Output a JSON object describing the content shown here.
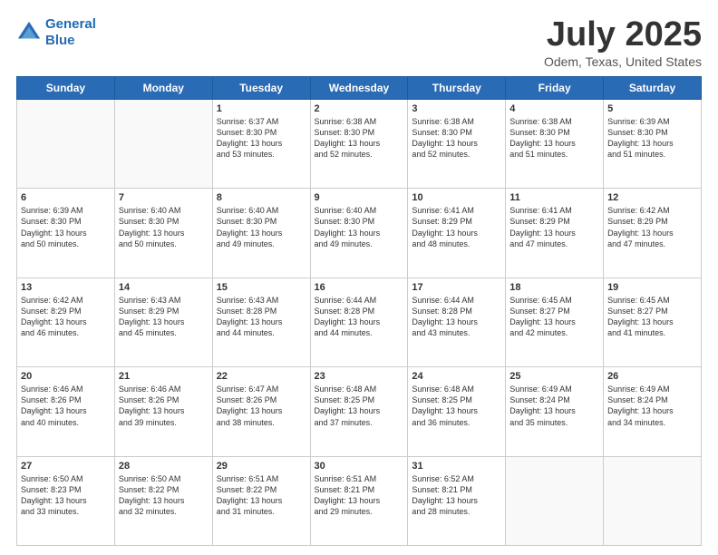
{
  "header": {
    "logo_line1": "General",
    "logo_line2": "Blue",
    "month": "July 2025",
    "location": "Odem, Texas, United States"
  },
  "weekdays": [
    "Sunday",
    "Monday",
    "Tuesday",
    "Wednesday",
    "Thursday",
    "Friday",
    "Saturday"
  ],
  "weeks": [
    [
      {
        "day": "",
        "text": ""
      },
      {
        "day": "",
        "text": ""
      },
      {
        "day": "1",
        "text": "Sunrise: 6:37 AM\nSunset: 8:30 PM\nDaylight: 13 hours\nand 53 minutes."
      },
      {
        "day": "2",
        "text": "Sunrise: 6:38 AM\nSunset: 8:30 PM\nDaylight: 13 hours\nand 52 minutes."
      },
      {
        "day": "3",
        "text": "Sunrise: 6:38 AM\nSunset: 8:30 PM\nDaylight: 13 hours\nand 52 minutes."
      },
      {
        "day": "4",
        "text": "Sunrise: 6:38 AM\nSunset: 8:30 PM\nDaylight: 13 hours\nand 51 minutes."
      },
      {
        "day": "5",
        "text": "Sunrise: 6:39 AM\nSunset: 8:30 PM\nDaylight: 13 hours\nand 51 minutes."
      }
    ],
    [
      {
        "day": "6",
        "text": "Sunrise: 6:39 AM\nSunset: 8:30 PM\nDaylight: 13 hours\nand 50 minutes."
      },
      {
        "day": "7",
        "text": "Sunrise: 6:40 AM\nSunset: 8:30 PM\nDaylight: 13 hours\nand 50 minutes."
      },
      {
        "day": "8",
        "text": "Sunrise: 6:40 AM\nSunset: 8:30 PM\nDaylight: 13 hours\nand 49 minutes."
      },
      {
        "day": "9",
        "text": "Sunrise: 6:40 AM\nSunset: 8:30 PM\nDaylight: 13 hours\nand 49 minutes."
      },
      {
        "day": "10",
        "text": "Sunrise: 6:41 AM\nSunset: 8:29 PM\nDaylight: 13 hours\nand 48 minutes."
      },
      {
        "day": "11",
        "text": "Sunrise: 6:41 AM\nSunset: 8:29 PM\nDaylight: 13 hours\nand 47 minutes."
      },
      {
        "day": "12",
        "text": "Sunrise: 6:42 AM\nSunset: 8:29 PM\nDaylight: 13 hours\nand 47 minutes."
      }
    ],
    [
      {
        "day": "13",
        "text": "Sunrise: 6:42 AM\nSunset: 8:29 PM\nDaylight: 13 hours\nand 46 minutes."
      },
      {
        "day": "14",
        "text": "Sunrise: 6:43 AM\nSunset: 8:29 PM\nDaylight: 13 hours\nand 45 minutes."
      },
      {
        "day": "15",
        "text": "Sunrise: 6:43 AM\nSunset: 8:28 PM\nDaylight: 13 hours\nand 44 minutes."
      },
      {
        "day": "16",
        "text": "Sunrise: 6:44 AM\nSunset: 8:28 PM\nDaylight: 13 hours\nand 44 minutes."
      },
      {
        "day": "17",
        "text": "Sunrise: 6:44 AM\nSunset: 8:28 PM\nDaylight: 13 hours\nand 43 minutes."
      },
      {
        "day": "18",
        "text": "Sunrise: 6:45 AM\nSunset: 8:27 PM\nDaylight: 13 hours\nand 42 minutes."
      },
      {
        "day": "19",
        "text": "Sunrise: 6:45 AM\nSunset: 8:27 PM\nDaylight: 13 hours\nand 41 minutes."
      }
    ],
    [
      {
        "day": "20",
        "text": "Sunrise: 6:46 AM\nSunset: 8:26 PM\nDaylight: 13 hours\nand 40 minutes."
      },
      {
        "day": "21",
        "text": "Sunrise: 6:46 AM\nSunset: 8:26 PM\nDaylight: 13 hours\nand 39 minutes."
      },
      {
        "day": "22",
        "text": "Sunrise: 6:47 AM\nSunset: 8:26 PM\nDaylight: 13 hours\nand 38 minutes."
      },
      {
        "day": "23",
        "text": "Sunrise: 6:48 AM\nSunset: 8:25 PM\nDaylight: 13 hours\nand 37 minutes."
      },
      {
        "day": "24",
        "text": "Sunrise: 6:48 AM\nSunset: 8:25 PM\nDaylight: 13 hours\nand 36 minutes."
      },
      {
        "day": "25",
        "text": "Sunrise: 6:49 AM\nSunset: 8:24 PM\nDaylight: 13 hours\nand 35 minutes."
      },
      {
        "day": "26",
        "text": "Sunrise: 6:49 AM\nSunset: 8:24 PM\nDaylight: 13 hours\nand 34 minutes."
      }
    ],
    [
      {
        "day": "27",
        "text": "Sunrise: 6:50 AM\nSunset: 8:23 PM\nDaylight: 13 hours\nand 33 minutes."
      },
      {
        "day": "28",
        "text": "Sunrise: 6:50 AM\nSunset: 8:22 PM\nDaylight: 13 hours\nand 32 minutes."
      },
      {
        "day": "29",
        "text": "Sunrise: 6:51 AM\nSunset: 8:22 PM\nDaylight: 13 hours\nand 31 minutes."
      },
      {
        "day": "30",
        "text": "Sunrise: 6:51 AM\nSunset: 8:21 PM\nDaylight: 13 hours\nand 29 minutes."
      },
      {
        "day": "31",
        "text": "Sunrise: 6:52 AM\nSunset: 8:21 PM\nDaylight: 13 hours\nand 28 minutes."
      },
      {
        "day": "",
        "text": ""
      },
      {
        "day": "",
        "text": ""
      }
    ]
  ]
}
